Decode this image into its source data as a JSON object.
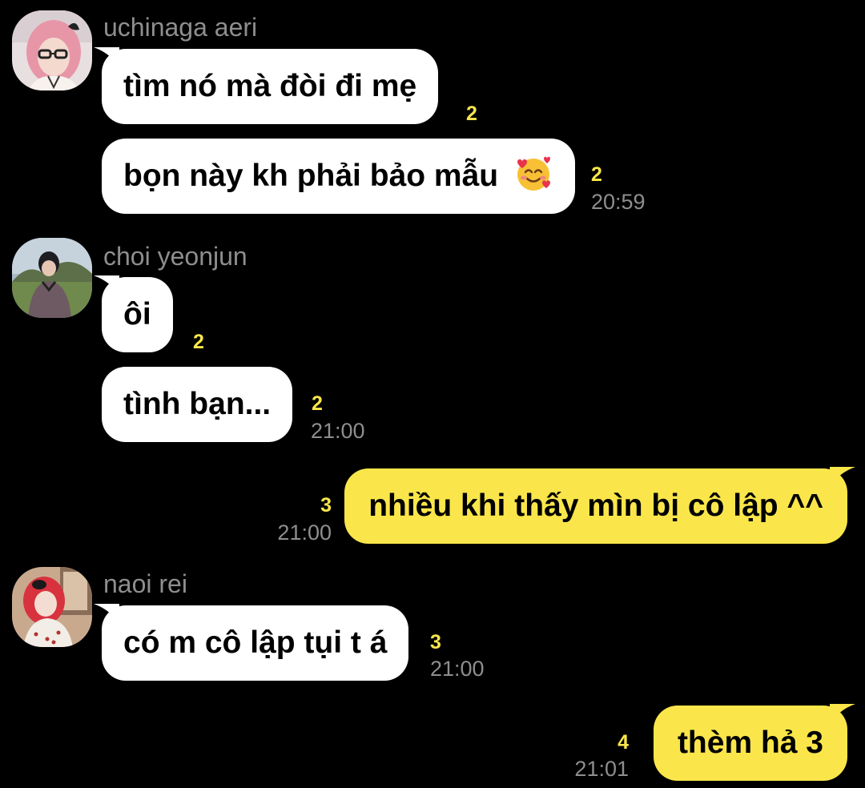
{
  "messages_in_1": {
    "sender": "uchinaga aeri",
    "bubble_1": {
      "text": "tìm nó mà đòi đi mẹ",
      "unread": "2"
    },
    "bubble_2": {
      "text": "bọn này kh phải bảo mẫu",
      "emoji": "smiling-face-with-hearts-icon",
      "unread": "2",
      "time": "20:59"
    }
  },
  "messages_in_2": {
    "sender": "choi yeonjun",
    "bubble_1": {
      "text": "ôi",
      "unread": "2"
    },
    "bubble_2": {
      "text": "tình bạn...",
      "unread": "2",
      "time": "21:00"
    }
  },
  "message_out_1": {
    "text": "nhiều khi thấy mìn bị cô lập ^^",
    "unread": "3",
    "time": "21:00"
  },
  "messages_in_3": {
    "sender": "naoi rei",
    "bubble_1": {
      "text": "có m cô lập tụi t á",
      "unread": "3",
      "time": "21:00"
    }
  },
  "message_out_2": {
    "text": "thèm hả 3",
    "unread": "4",
    "time": "21:01"
  },
  "colors": {
    "background": "#000000",
    "incoming_bubble": "#ffffff",
    "outgoing_bubble": "#fae64a",
    "unread_count": "#fae64a",
    "meta_text": "#8e8e8e"
  }
}
